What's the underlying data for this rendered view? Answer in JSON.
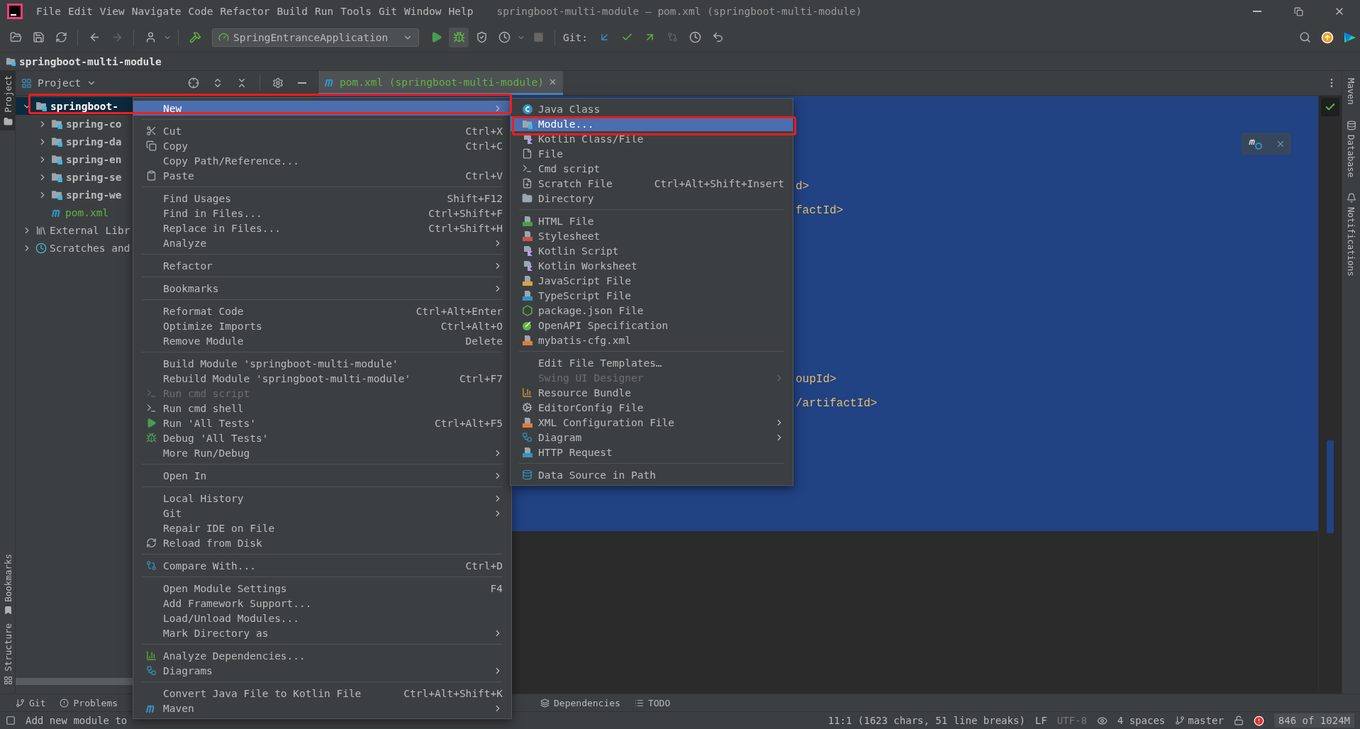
{
  "window": {
    "title": "springboot-multi-module – pom.xml (springboot-multi-module)"
  },
  "menu_bar": [
    "File",
    "Edit",
    "View",
    "Navigate",
    "Code",
    "Refactor",
    "Build",
    "Run",
    "Tools",
    "Git",
    "Window",
    "Help"
  ],
  "toolbar": {
    "run_configuration": "SpringEntranceApplication",
    "git_label": "Git:"
  },
  "nav_bar": {
    "path": "springboot-multi-module"
  },
  "left_stripe": [
    {
      "label": "Project",
      "selected": true
    },
    {
      "label": "Bookmarks",
      "selected": false
    },
    {
      "label": "Structure",
      "selected": false
    }
  ],
  "right_stripe": [
    {
      "label": "Maven"
    },
    {
      "label": "Database"
    },
    {
      "label": "Notifications"
    }
  ],
  "project_panel": {
    "title": "Project",
    "tree": [
      {
        "label": "springboot-",
        "kind": "module",
        "expanded": true,
        "selected": true,
        "children": [
          {
            "label": "spring-co",
            "kind": "module",
            "expanded": false,
            "selected": false
          },
          {
            "label": "spring-da",
            "kind": "module",
            "expanded": false,
            "selected": false
          },
          {
            "label": "spring-en",
            "kind": "module",
            "expanded": false,
            "selected": false
          },
          {
            "label": "spring-se",
            "kind": "module",
            "expanded": false,
            "selected": false
          },
          {
            "label": "spring-we",
            "kind": "module",
            "expanded": false,
            "selected": false
          },
          {
            "label": "pom.xml",
            "kind": "maven",
            "selected": false
          }
        ]
      },
      {
        "label": "External Libr",
        "kind": "library",
        "expanded": false,
        "selected": false
      },
      {
        "label": "Scratches and",
        "kind": "scratches",
        "expanded": false,
        "selected": false
      }
    ]
  },
  "editor": {
    "tabs": [
      {
        "label": "pom.xml (springboot-multi-module)",
        "selected": true
      }
    ],
    "lines": [
      "d>",
      "factId>",
      "oupId>",
      "/artifactId>"
    ]
  },
  "context_menu": {
    "groups": [
      [
        {
          "label": "New",
          "submenu": true,
          "disabled": false,
          "selected": true
        }
      ],
      [
        {
          "label": "Cut",
          "shortcut": "Ctrl+X",
          "submenu": false,
          "disabled": false,
          "selected": false
        },
        {
          "label": "Copy",
          "shortcut": "Ctrl+C",
          "submenu": false,
          "disabled": false,
          "selected": false
        },
        {
          "label": "Copy Path/Reference...",
          "submenu": false,
          "disabled": false,
          "selected": false
        },
        {
          "label": "Paste",
          "shortcut": "Ctrl+V",
          "submenu": false,
          "disabled": false,
          "selected": false
        }
      ],
      [
        {
          "label": "Find Usages",
          "shortcut": "Shift+F12",
          "submenu": false,
          "disabled": false,
          "selected": false
        },
        {
          "label": "Find in Files...",
          "shortcut": "Ctrl+Shift+F",
          "submenu": false,
          "disabled": false,
          "selected": false
        },
        {
          "label": "Replace in Files...",
          "shortcut": "Ctrl+Shift+H",
          "submenu": false,
          "disabled": false,
          "selected": false
        },
        {
          "label": "Analyze",
          "submenu": true,
          "disabled": false,
          "selected": false
        }
      ],
      [
        {
          "label": "Refactor",
          "submenu": true,
          "disabled": false,
          "selected": false
        }
      ],
      [
        {
          "label": "Bookmarks",
          "submenu": true,
          "disabled": false,
          "selected": false
        }
      ],
      [
        {
          "label": "Reformat Code",
          "shortcut": "Ctrl+Alt+Enter",
          "submenu": false,
          "disabled": false,
          "selected": false
        },
        {
          "label": "Optimize Imports",
          "shortcut": "Ctrl+Alt+O",
          "submenu": false,
          "disabled": false,
          "selected": false
        },
        {
          "label": "Remove Module",
          "shortcut": "Delete",
          "submenu": false,
          "disabled": false,
          "selected": false
        }
      ],
      [
        {
          "label": "Build Module 'springboot-multi-module'",
          "submenu": false,
          "disabled": false,
          "selected": false
        },
        {
          "label": "Rebuild Module 'springboot-multi-module'",
          "shortcut": "Ctrl+F7",
          "submenu": false,
          "disabled": false,
          "selected": false
        },
        {
          "label": "Run cmd script",
          "submenu": false,
          "disabled": true,
          "selected": false
        },
        {
          "label": "Run cmd shell",
          "submenu": false,
          "disabled": false,
          "selected": false
        },
        {
          "label": "Run 'All Tests'",
          "shortcut": "Ctrl+Alt+F5",
          "submenu": false,
          "disabled": false,
          "selected": false
        },
        {
          "label": "Debug 'All Tests'",
          "submenu": false,
          "disabled": false,
          "selected": false
        },
        {
          "label": "More Run/Debug",
          "submenu": true,
          "disabled": false,
          "selected": false
        }
      ],
      [
        {
          "label": "Open In",
          "submenu": true,
          "disabled": false,
          "selected": false
        }
      ],
      [
        {
          "label": "Local History",
          "submenu": true,
          "disabled": false,
          "selected": false
        },
        {
          "label": "Git",
          "submenu": true,
          "disabled": false,
          "selected": false
        },
        {
          "label": "Repair IDE on File",
          "submenu": false,
          "disabled": false,
          "selected": false
        },
        {
          "label": "Reload from Disk",
          "submenu": false,
          "disabled": false,
          "selected": false
        }
      ],
      [
        {
          "label": "Compare With...",
          "shortcut": "Ctrl+D",
          "submenu": false,
          "disabled": false,
          "selected": false
        }
      ],
      [
        {
          "label": "Open Module Settings",
          "shortcut": "F4",
          "submenu": false,
          "disabled": false,
          "selected": false
        },
        {
          "label": "Add Framework Support...",
          "submenu": false,
          "disabled": false,
          "selected": false
        },
        {
          "label": "Load/Unload Modules...",
          "submenu": false,
          "disabled": false,
          "selected": false
        },
        {
          "label": "Mark Directory as",
          "submenu": true,
          "disabled": false,
          "selected": false
        }
      ],
      [
        {
          "label": "Analyze Dependencies...",
          "submenu": false,
          "disabled": false,
          "selected": false
        },
        {
          "label": "Diagrams",
          "submenu": true,
          "disabled": false,
          "selected": false
        }
      ],
      [
        {
          "label": "Convert Java File to Kotlin File",
          "shortcut": "Ctrl+Alt+Shift+K",
          "submenu": false,
          "disabled": false,
          "selected": false
        },
        {
          "label": "Maven",
          "submenu": true,
          "disabled": false,
          "selected": false
        }
      ]
    ]
  },
  "new_submenu": {
    "groups": [
      [
        {
          "label": "Java Class",
          "submenu": false,
          "disabled": false,
          "selected": false
        },
        {
          "label": "Module...",
          "submenu": false,
          "disabled": false,
          "selected": true
        },
        {
          "label": "Kotlin Class/File",
          "submenu": false,
          "disabled": false,
          "selected": false
        },
        {
          "label": "File",
          "submenu": false,
          "disabled": false,
          "selected": false
        },
        {
          "label": "Cmd script",
          "submenu": false,
          "disabled": false,
          "selected": false
        },
        {
          "label": "Scratch File",
          "shortcut": "Ctrl+Alt+Shift+Insert",
          "submenu": false,
          "disabled": false,
          "selected": false
        },
        {
          "label": "Directory",
          "submenu": false,
          "disabled": false,
          "selected": false
        }
      ],
      [
        {
          "label": "HTML File",
          "submenu": false,
          "disabled": false,
          "selected": false
        },
        {
          "label": "Stylesheet",
          "submenu": false,
          "disabled": false,
          "selected": false
        },
        {
          "label": "Kotlin Script",
          "submenu": false,
          "disabled": false,
          "selected": false
        },
        {
          "label": "Kotlin Worksheet",
          "submenu": false,
          "disabled": false,
          "selected": false
        },
        {
          "label": "JavaScript File",
          "submenu": false,
          "disabled": false,
          "selected": false
        },
        {
          "label": "TypeScript File",
          "submenu": false,
          "disabled": false,
          "selected": false
        },
        {
          "label": "package.json File",
          "submenu": false,
          "disabled": false,
          "selected": false
        },
        {
          "label": "OpenAPI Specification",
          "submenu": false,
          "disabled": false,
          "selected": false
        },
        {
          "label": "mybatis-cfg.xml",
          "submenu": false,
          "disabled": false,
          "selected": false
        }
      ],
      [
        {
          "label": "Edit File Templates…",
          "submenu": false,
          "disabled": false,
          "selected": false
        },
        {
          "label": "Swing UI Designer",
          "submenu": true,
          "disabled": true,
          "selected": false
        },
        {
          "label": "Resource Bundle",
          "submenu": false,
          "disabled": false,
          "selected": false
        },
        {
          "label": "EditorConfig File",
          "submenu": false,
          "disabled": false,
          "selected": false
        },
        {
          "label": "XML Configuration File",
          "submenu": true,
          "disabled": false,
          "selected": false
        },
        {
          "label": "Diagram",
          "submenu": true,
          "disabled": false,
          "selected": false
        },
        {
          "label": "HTTP Request",
          "submenu": false,
          "disabled": false,
          "selected": false
        }
      ],
      [
        {
          "label": "Data Source in Path",
          "submenu": false,
          "disabled": false,
          "selected": false
        }
      ]
    ]
  },
  "bottom_tools": {
    "left": [
      "Git",
      "Problems"
    ],
    "center": [
      "Dependencies",
      "TODO"
    ]
  },
  "status_bar": {
    "message": "Add new module to",
    "position": "11:1 (1623 chars, 51 line breaks)",
    "line_separator": "LF",
    "encoding": "UTF-8",
    "indent": "4 spaces",
    "branch": "master",
    "memory": "846 of 1024M"
  }
}
